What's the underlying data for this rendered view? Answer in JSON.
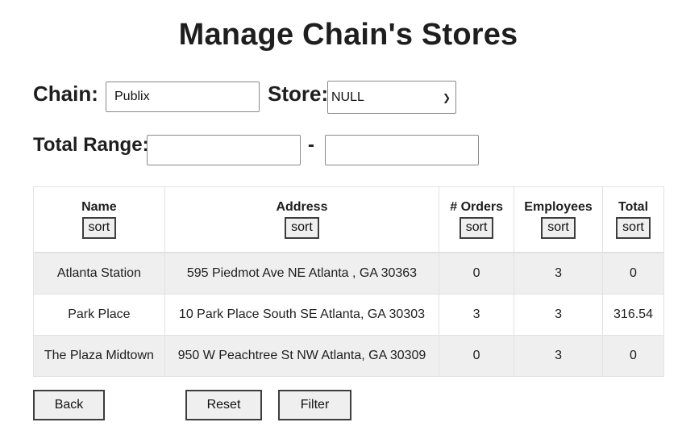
{
  "page": {
    "title": "Manage Chain's Stores"
  },
  "filters": {
    "chain_label": "Chain:",
    "chain_value": "Publix",
    "store_label": "Store:",
    "store_selected": "NULL",
    "total_range_label": "Total Range:",
    "range_separator": "-",
    "range_min": "",
    "range_max": ""
  },
  "table": {
    "sort_label": "sort",
    "columns": [
      "Name",
      "Address",
      "# Orders",
      "Employees",
      "Total"
    ],
    "rows": [
      [
        "Atlanta Station",
        "595 Piedmot Ave NE Atlanta , GA 30363",
        "0",
        "3",
        "0"
      ],
      [
        "Park Place",
        "10 Park Place South SE Atlanta, GA 30303",
        "3",
        "3",
        "316.54"
      ],
      [
        "The Plaza Midtown",
        "950 W Peachtree St NW Atlanta, GA 30309",
        "0",
        "3",
        "0"
      ]
    ]
  },
  "actions": {
    "back": "Back",
    "reset": "Reset",
    "filter": "Filter"
  },
  "icons": {
    "store_select_arrow": "chevron-down-icon"
  }
}
